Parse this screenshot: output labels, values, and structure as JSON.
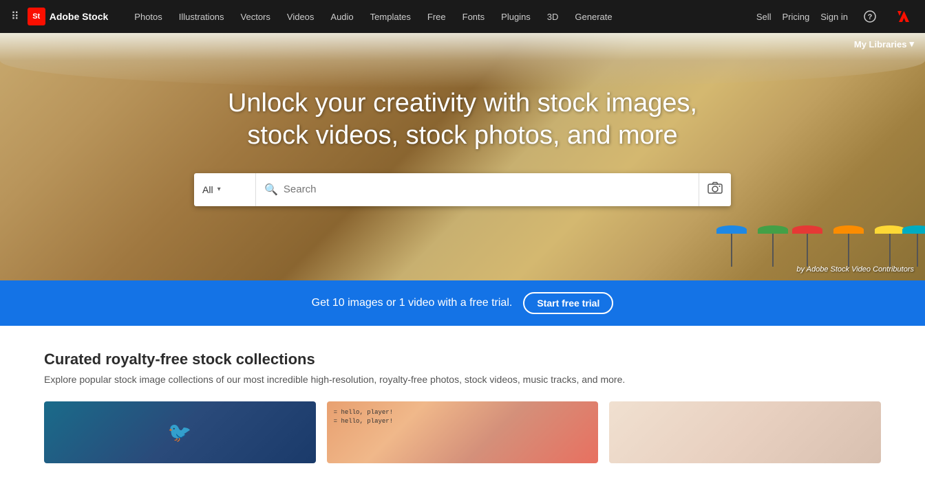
{
  "navbar": {
    "logo_letters": "St",
    "logo_name": "Adobe Stock",
    "nav_items": [
      {
        "label": "Photos",
        "id": "photos"
      },
      {
        "label": "Illustrations",
        "id": "illustrations"
      },
      {
        "label": "Vectors",
        "id": "vectors"
      },
      {
        "label": "Videos",
        "id": "videos"
      },
      {
        "label": "Audio",
        "id": "audio"
      },
      {
        "label": "Templates",
        "id": "templates"
      },
      {
        "label": "Free",
        "id": "free"
      },
      {
        "label": "Fonts",
        "id": "fonts"
      },
      {
        "label": "Plugins",
        "id": "plugins"
      },
      {
        "label": "3D",
        "id": "3d"
      },
      {
        "label": "Generate",
        "id": "generate"
      }
    ],
    "right_links": [
      {
        "label": "Sell",
        "id": "sell"
      },
      {
        "label": "Pricing",
        "id": "pricing"
      },
      {
        "label": "Sign in",
        "id": "signin"
      }
    ]
  },
  "hero": {
    "title": "Unlock your creativity with stock images, stock videos, stock photos, and more",
    "search_placeholder": "Search",
    "search_category": "All",
    "attribution": "by Adobe Stock Video Contributors",
    "my_libraries_label": "My Libraries"
  },
  "promo": {
    "text": "Get 10 images or 1 video with a free trial.",
    "cta_label": "Start free trial"
  },
  "collections": {
    "title": "Curated royalty-free stock collections",
    "subtitle": "Explore popular stock image collections of our most incredible high-resolution, royalty-free photos, stock videos, music tracks, and more."
  }
}
